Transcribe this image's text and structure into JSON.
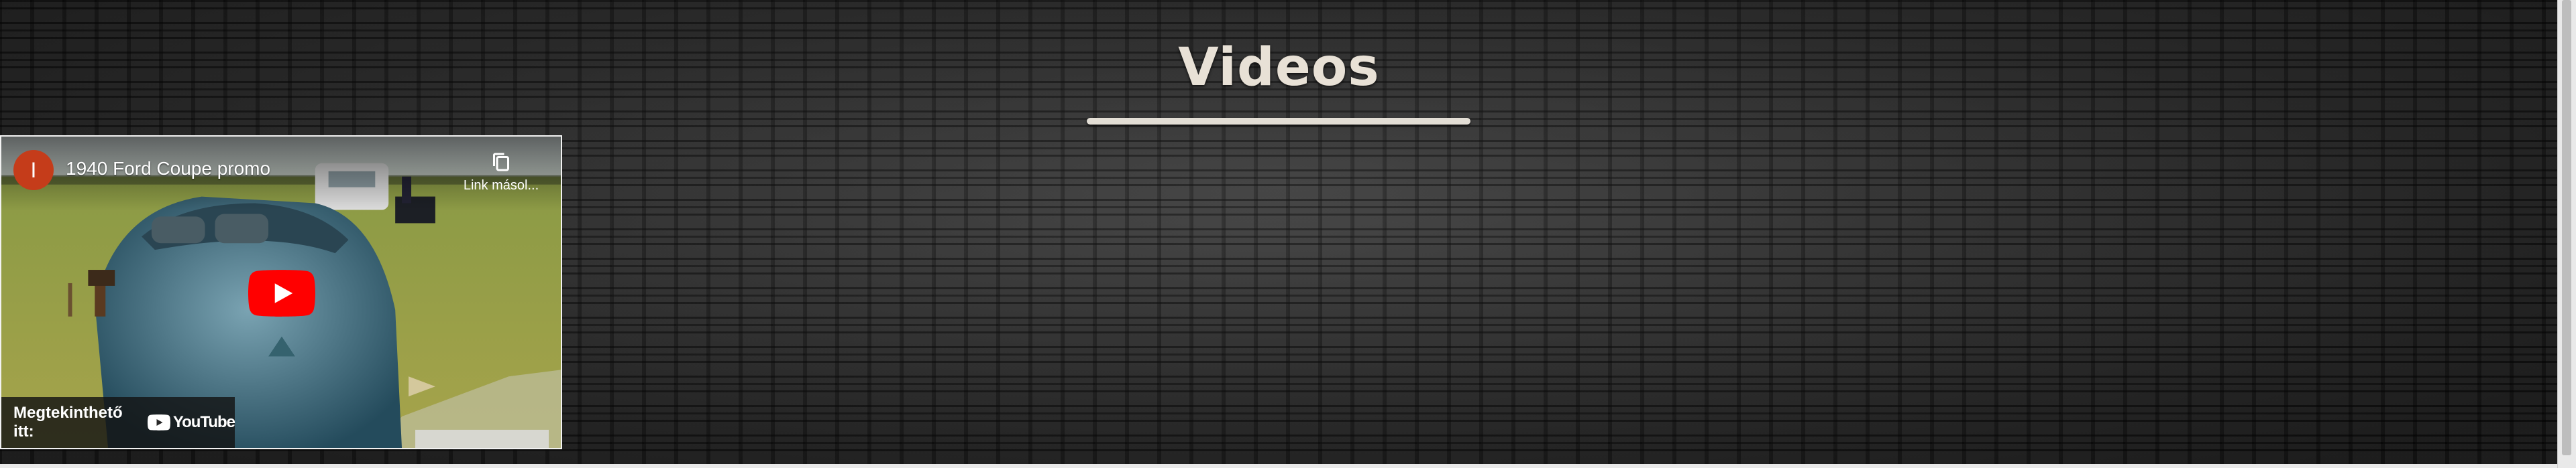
{
  "section": {
    "title": "Videos"
  },
  "video": {
    "channel_initial": "I",
    "title": "1940 Ford Coupe promo",
    "copy_link_label": "Link másol...",
    "watch_on_label": "Megtekinthető itt:",
    "youtube_label": "YouTube"
  },
  "colors": {
    "title_text": "#e8e1d6",
    "underline": "#e3ded5",
    "youtube_red": "#ff0000",
    "avatar": "#c53c1a"
  }
}
